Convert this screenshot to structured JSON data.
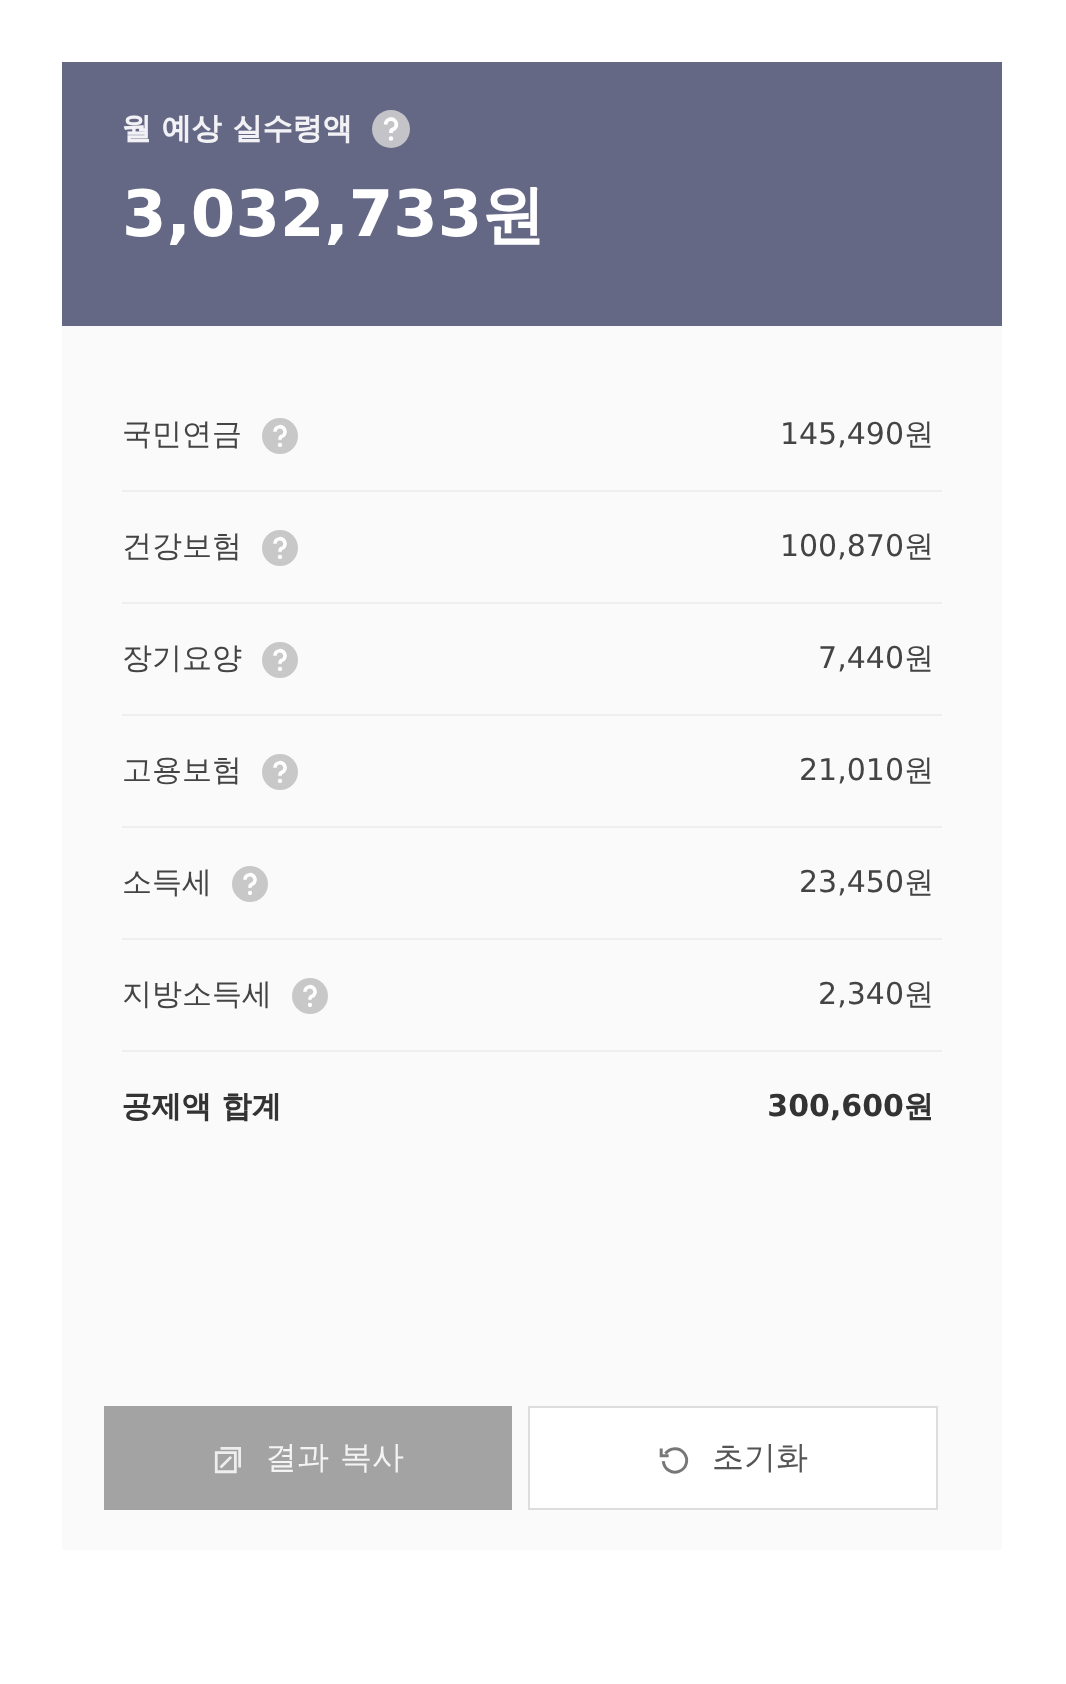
{
  "header": {
    "title": "월 예상 실수령액",
    "amount": "3,032,733원"
  },
  "rows": [
    {
      "kind": "item",
      "label": "국민연금",
      "value": "145,490원"
    },
    {
      "kind": "item",
      "label": "건강보험",
      "value": "100,870원"
    },
    {
      "kind": "item",
      "label": "장기요양",
      "value": "7,440원"
    },
    {
      "kind": "item",
      "label": "고용보험",
      "value": "21,010원"
    },
    {
      "kind": "item",
      "label": "소득세",
      "value": "23,450원"
    },
    {
      "kind": "item",
      "label": "지방소득세",
      "value": "2,340원"
    },
    {
      "kind": "total",
      "label": "공제액 합계",
      "value": "300,600원"
    }
  ],
  "buttons": [
    {
      "kind": "copy",
      "label": "결과 복사"
    },
    {
      "kind": "reset",
      "label": "초기화"
    }
  ]
}
